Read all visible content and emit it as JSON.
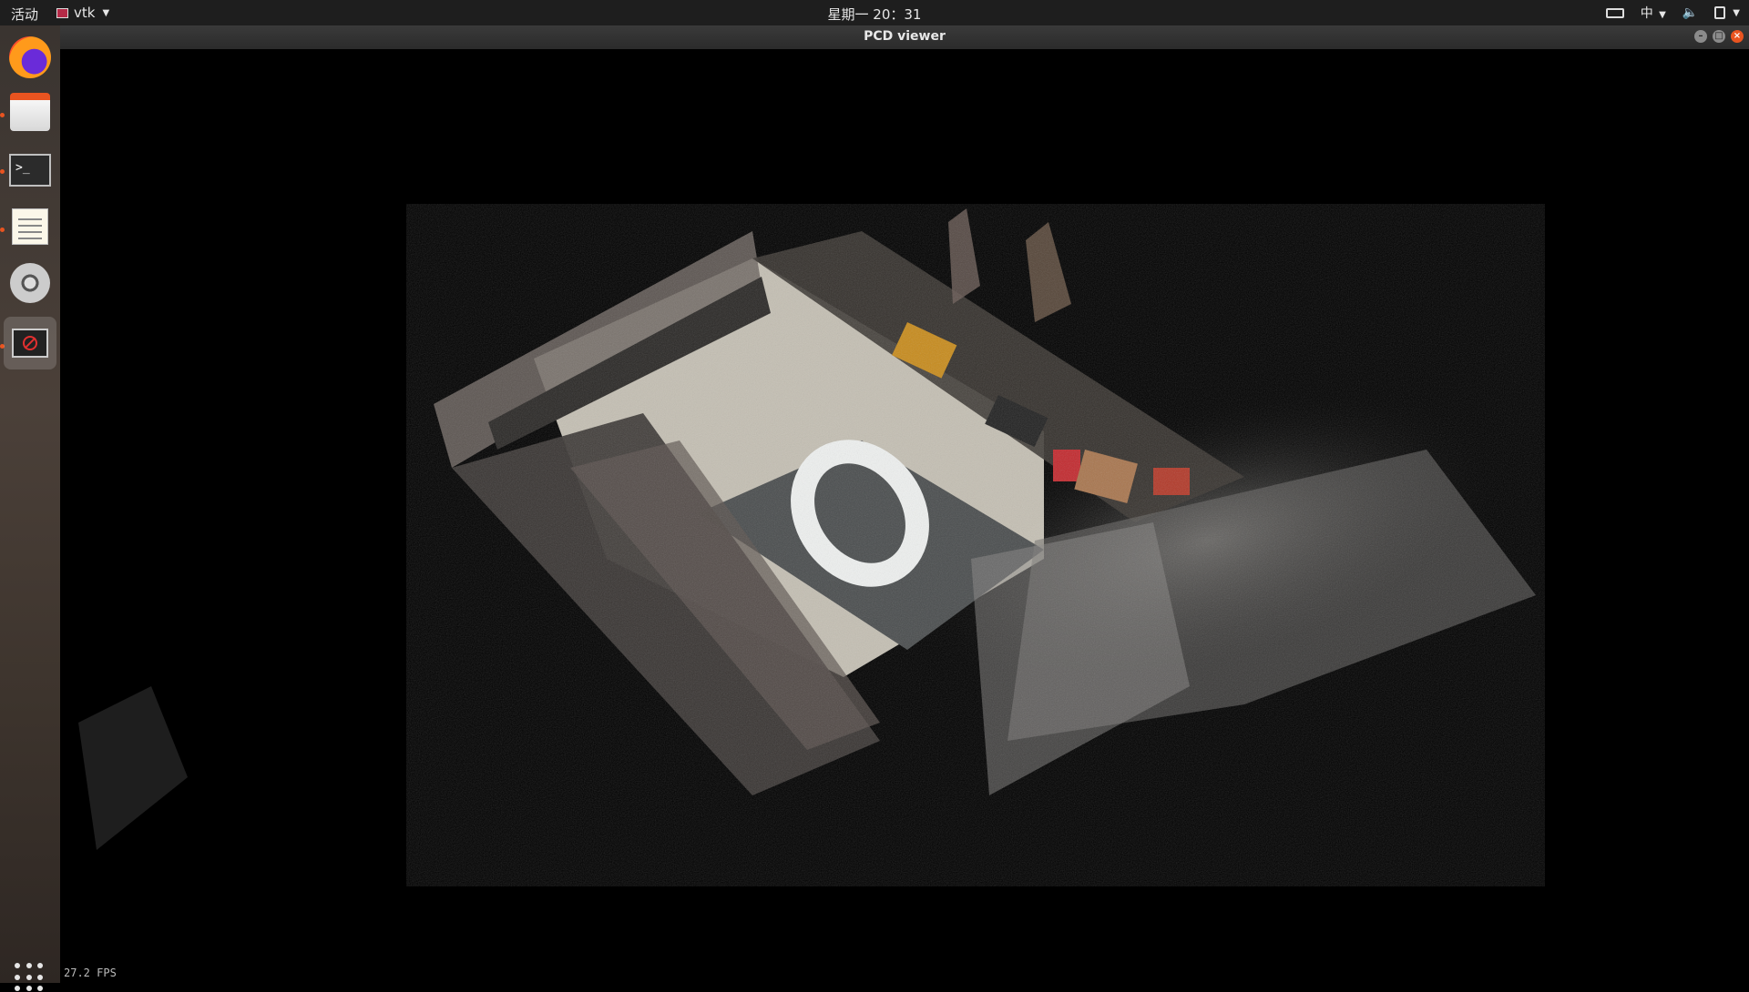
{
  "topbar": {
    "activities": "活动",
    "app_name": "vtk",
    "clock": "星期一 20：31",
    "input_method": "中"
  },
  "window": {
    "title": "PCD viewer",
    "minimize": "–",
    "maximize": "□",
    "close": "×"
  },
  "dock": {
    "items": [
      "firefox-icon",
      "files-icon",
      "terminal-icon",
      "text-editor-icon",
      "video-icon",
      "pcd-viewer-icon"
    ],
    "terminal_prompt": ">_"
  },
  "viewer": {
    "fps_text": "27.2 FPS",
    "floor_marker": "0",
    "colors": {
      "background": "#000000",
      "floor": "#d9d4c7",
      "mat": "#4a4d4e",
      "marker": "#eef0ef"
    }
  }
}
